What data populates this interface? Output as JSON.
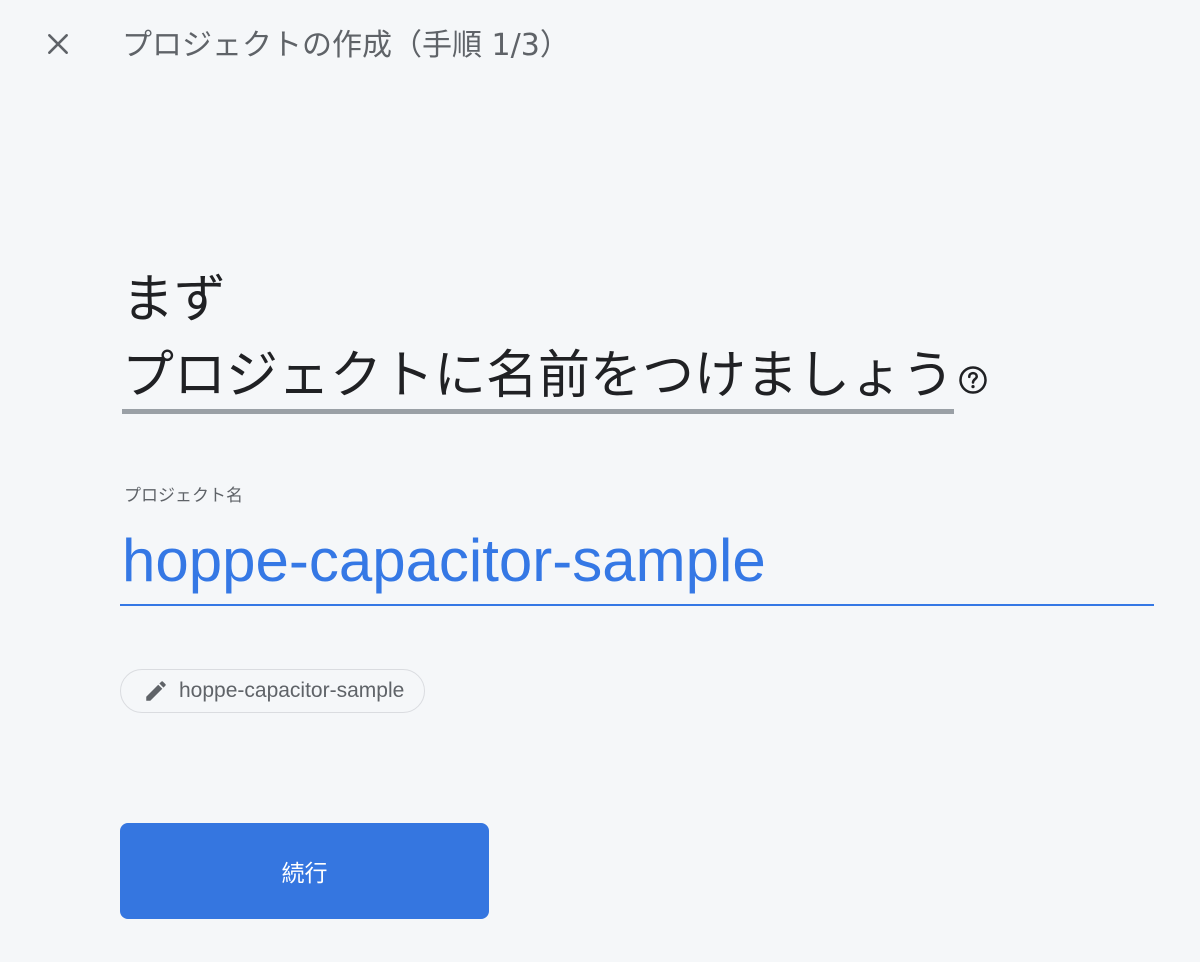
{
  "header": {
    "close_icon": "close-icon",
    "title": "プロジェクトの作成（手順 1/3）"
  },
  "main": {
    "heading_line1": "まず",
    "heading_line2": "プロジェクトに名前をつけましょう",
    "help_icon": "help-circle-icon",
    "field_label": "プロジェクト名",
    "project_name_value": "hoppe-capacitor-sample",
    "project_id_chip": {
      "icon": "pencil-icon",
      "text": "hoppe-capacitor-sample"
    },
    "continue_label": "続行"
  },
  "colors": {
    "accent": "#3578e5",
    "background": "#f5f7f9",
    "muted_text": "#5f6368",
    "button_bg": "#3576e0"
  }
}
